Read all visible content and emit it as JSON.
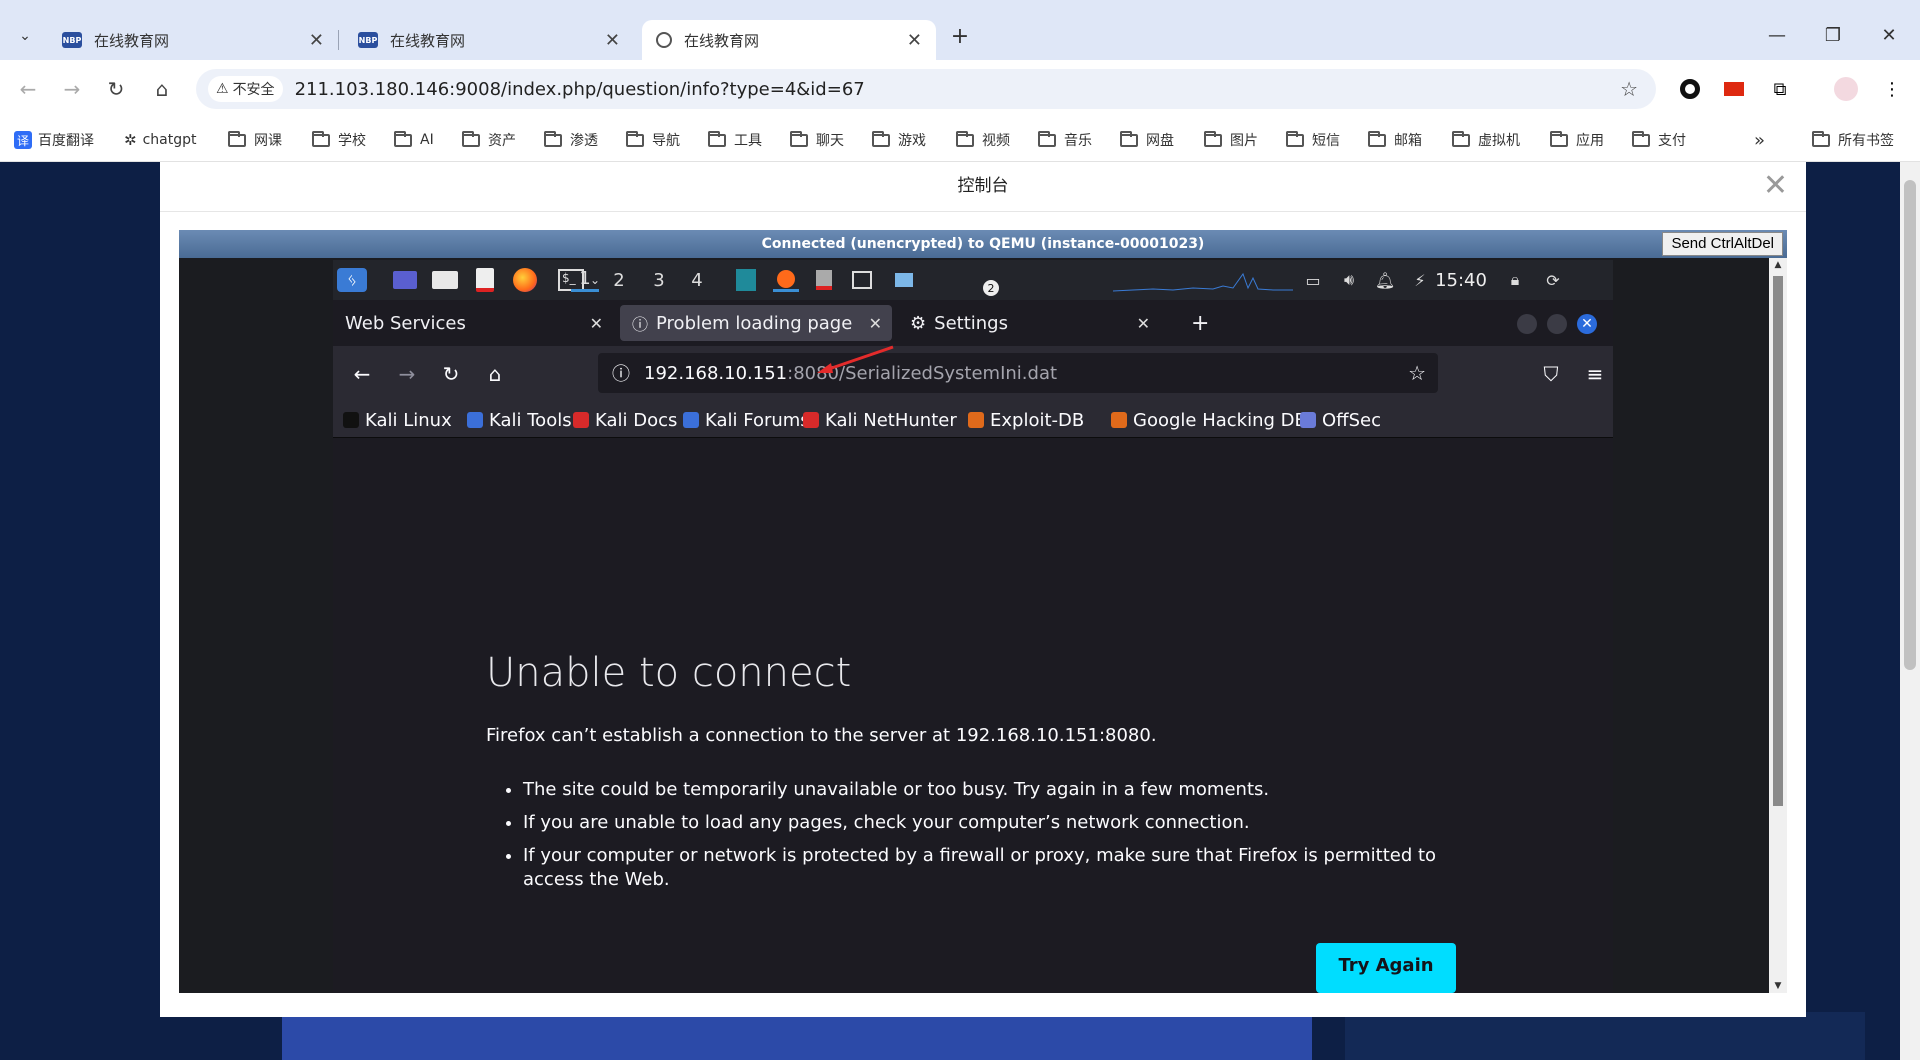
{
  "chrome": {
    "tabs": [
      {
        "title": "在线教育网",
        "favicon": "NBP"
      },
      {
        "title": "在线教育网",
        "favicon": "NBP"
      },
      {
        "title": "在线教育网",
        "favicon": "globe-icon"
      }
    ],
    "insecure_label": "不安全",
    "url": "211.103.180.146:9008/index.php/question/info?type=4&id=67",
    "bookmarks": [
      "百度翻译",
      "chatgpt",
      "网课",
      "学校",
      "AI",
      "资产",
      "渗透",
      "导航",
      "工具",
      "聊天",
      "游戏",
      "视频",
      "音乐",
      "网盘",
      "图片",
      "短信",
      "邮箱",
      "虚拟机",
      "应用",
      "支付"
    ],
    "bookmarks_more": "»",
    "all_bookmarks": "所有书签",
    "translate_icon_text": "译"
  },
  "modal": {
    "title": "控制台",
    "close": "✕"
  },
  "vnc": {
    "status": "Connected (unencrypted) to QEMU (instance-00001023)",
    "ctrlaltdel": "Send CtrlAltDel"
  },
  "kali": {
    "workspaces": [
      "1",
      "2",
      "3",
      "4"
    ],
    "badge": "2",
    "time": "15:40"
  },
  "firefox": {
    "tabs": [
      {
        "title": "Web Services"
      },
      {
        "title": "Problem loading page"
      },
      {
        "title": "Settings"
      }
    ],
    "url_host": "192.168.10.151",
    "url_path": ":8080/SerializedSystemIni.dat",
    "bookmarks": [
      {
        "label": "Kali Linux",
        "color": "#111111"
      },
      {
        "label": "Kali Tools",
        "color": "#3b6fd9"
      },
      {
        "label": "Kali Docs",
        "color": "#d72a2a"
      },
      {
        "label": "Kali Forums",
        "color": "#3b6fd9"
      },
      {
        "label": "Kali NetHunter",
        "color": "#d72a2a"
      },
      {
        "label": "Exploit-DB",
        "color": "#e06a1b"
      },
      {
        "label": "Google Hacking DB",
        "color": "#e06a1b"
      },
      {
        "label": "OffSec",
        "color": "#6a7bd9"
      }
    ],
    "error": {
      "title": "Unable to connect",
      "description": "Firefox can’t establish a connection to the server at 192.168.10.151:8080.",
      "items": [
        "The site could be temporarily unavailable or too busy. Try again in a few moments.",
        "If you are unable to load any pages, check your computer’s network connection.",
        "If your computer or network is protected by a firewall or proxy, make sure that Firefox is permitted to access the Web."
      ],
      "try_again": "Try Again"
    }
  }
}
